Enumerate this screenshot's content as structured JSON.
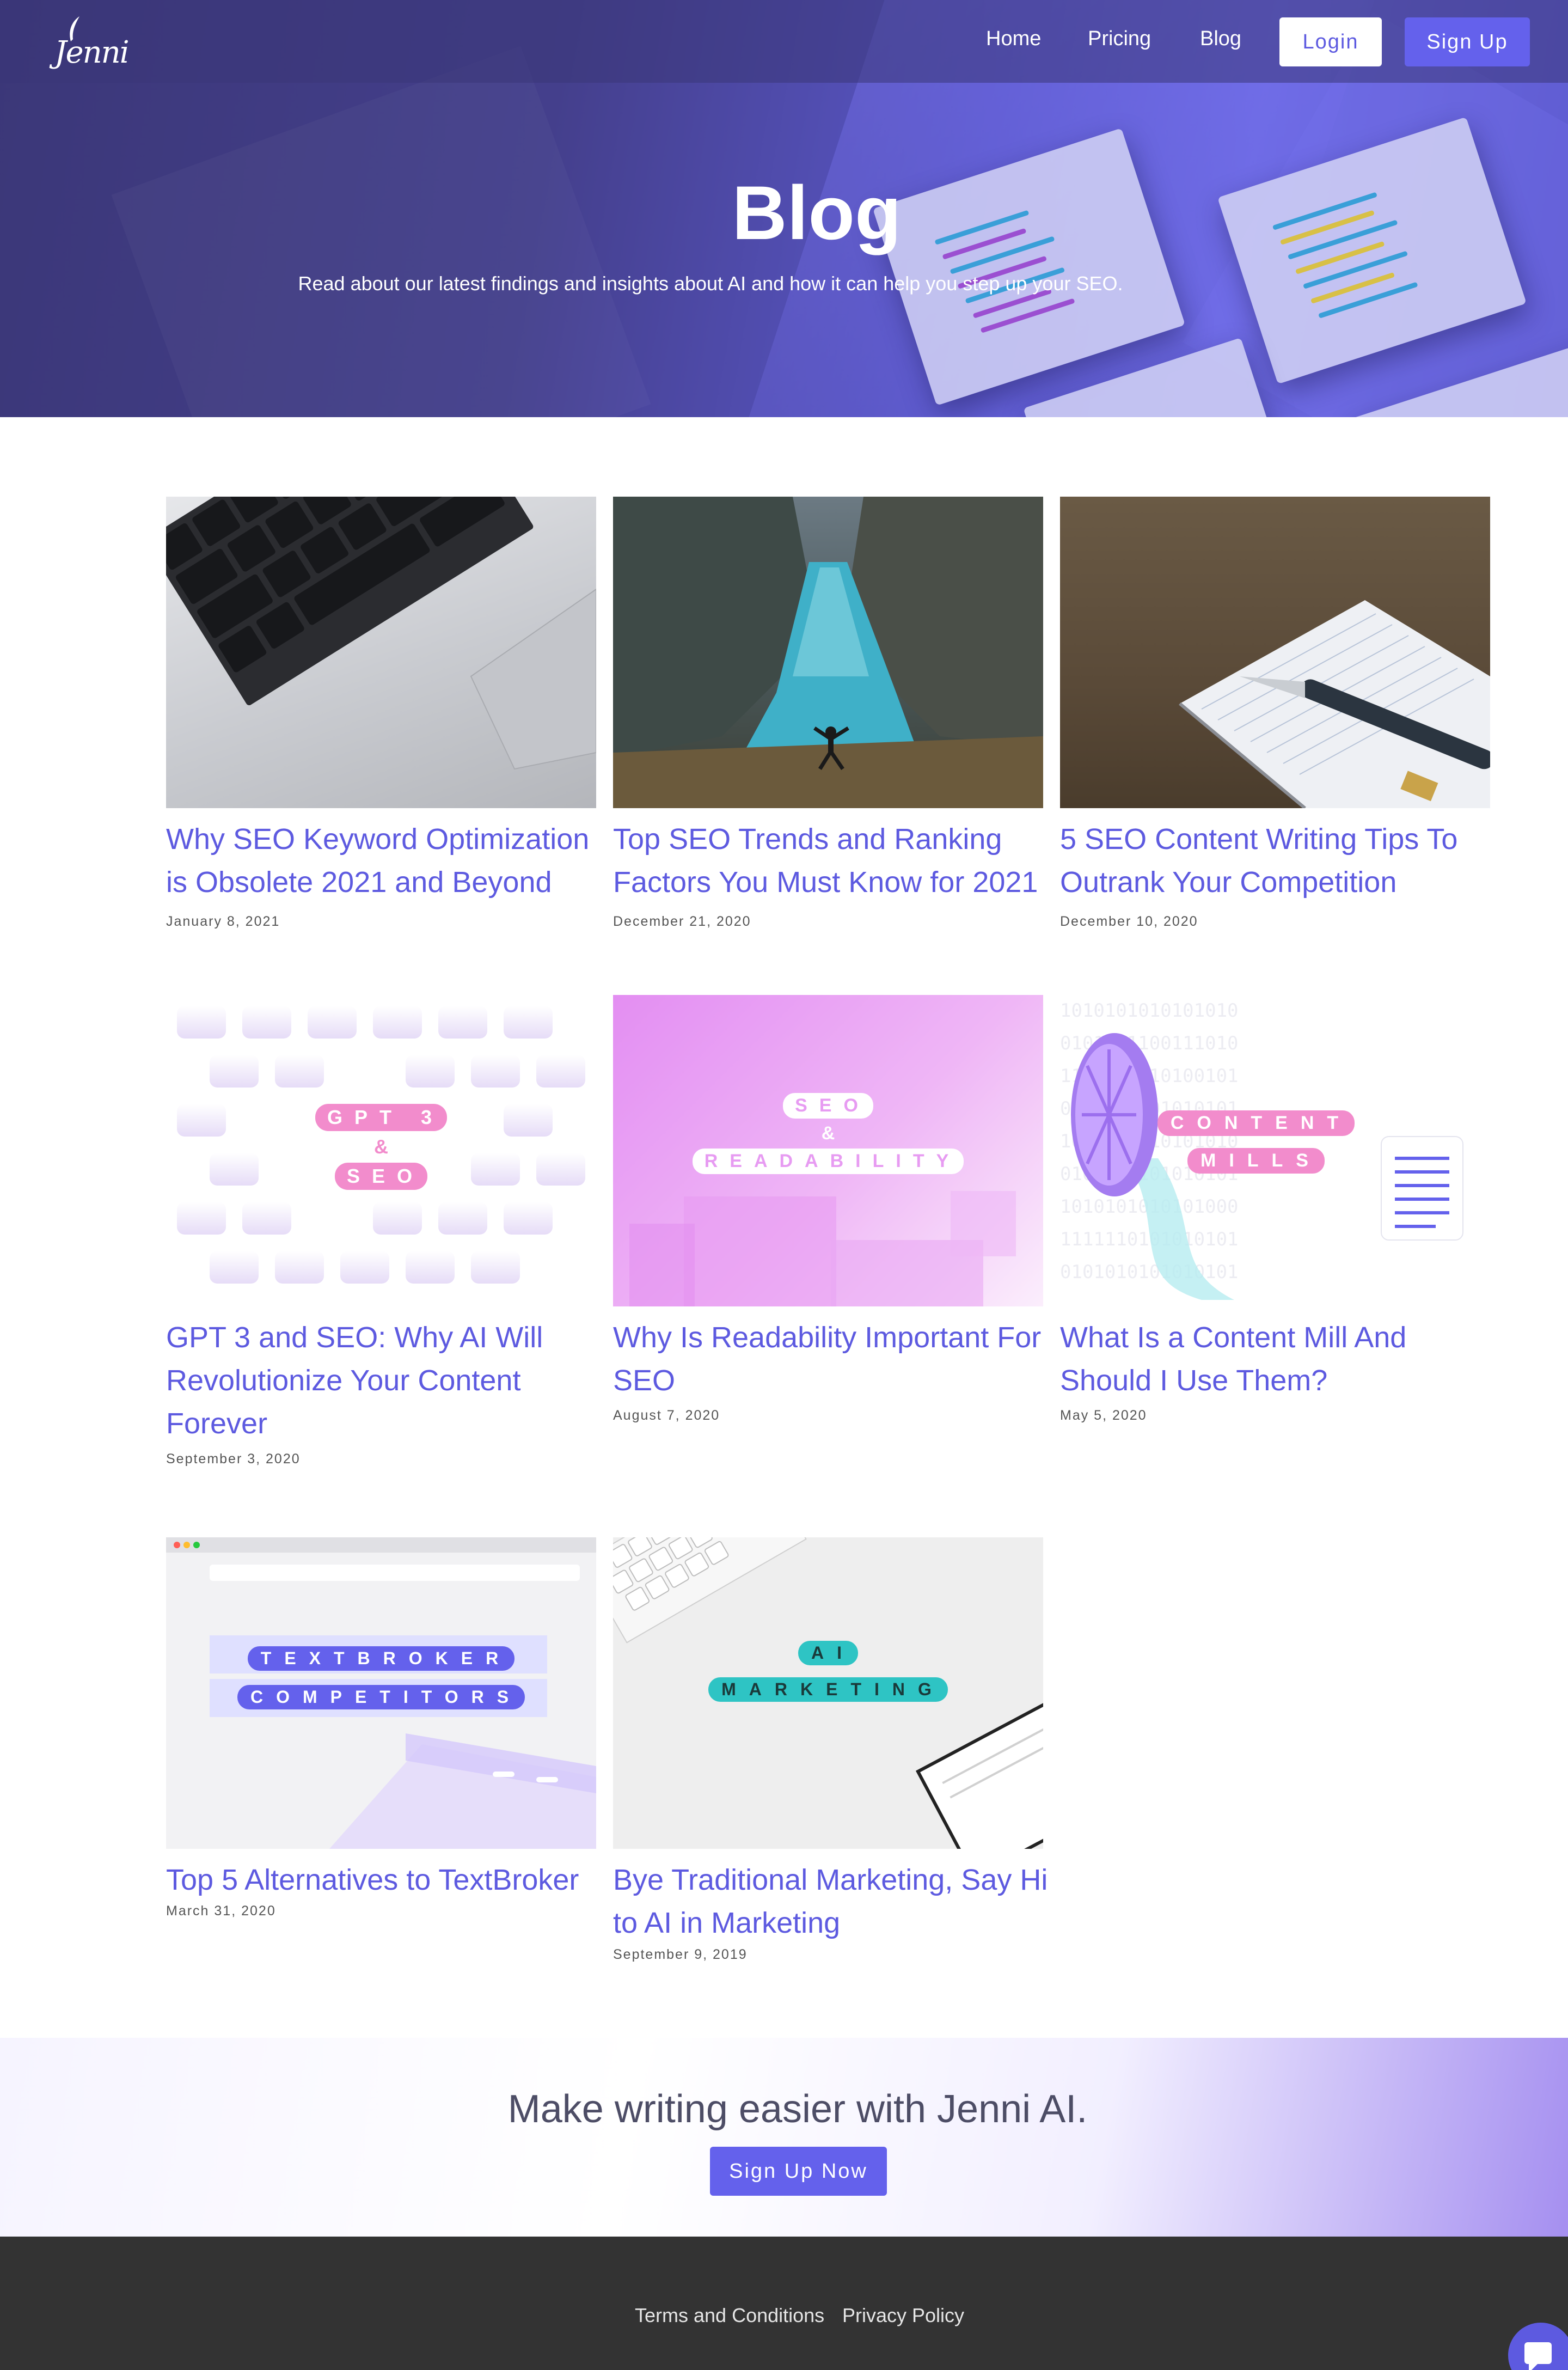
{
  "header": {
    "logo_text": "Jenni",
    "nav": [
      "Home",
      "Pricing",
      "Blog"
    ],
    "login_label": "Login",
    "signup_label": "Sign Up"
  },
  "hero": {
    "title": "Blog",
    "subtitle": "Read about our latest findings and insights about AI and how it can help you step up your SEO."
  },
  "posts": [
    {
      "title": "Why SEO Keyword Optimization is Obsolete 2021 and Beyond",
      "date": "January 8, 2021"
    },
    {
      "title": "Top SEO Trends and Ranking Factors You Must Know for 2021",
      "date": "December 21, 2020"
    },
    {
      "title": "5 SEO Content Writing Tips To Outrank Your Competition",
      "date": "December 10, 2020"
    },
    {
      "title": "GPT 3 and SEO: Why AI Will Revolutionize Your Content Forever",
      "date": "September 3, 2020",
      "image_text": [
        "GPT 3",
        "&",
        "SEO"
      ]
    },
    {
      "title": "Why Is Readability Important For SEO",
      "date": "August 7, 2020",
      "image_text": [
        "SEO",
        "&",
        "READABILITY"
      ]
    },
    {
      "title": "What Is a Content Mill And Should I Use Them?",
      "date": "May 5, 2020",
      "image_text": [
        "CONTENT",
        "MILLS"
      ]
    },
    {
      "title": "Top 5 Alternatives to TextBroker",
      "date": "March 31, 2020",
      "image_text": [
        "TEXTBROKER",
        "COMPETITORS"
      ]
    },
    {
      "title": "Bye Traditional Marketing, Say Hi to AI in Marketing",
      "date": "September 9, 2019",
      "image_text": [
        "AI",
        "MARKETING"
      ]
    }
  ],
  "cta": {
    "title": "Make writing easier with Jenni AI.",
    "button_label": "Sign Up Now"
  },
  "footer": {
    "terms_label": "Terms and Conditions",
    "privacy_label": "Privacy Policy"
  },
  "colors": {
    "accent": "#5d5ae0",
    "hero_dark": "#3b3778",
    "footer_bg": "#333333"
  }
}
